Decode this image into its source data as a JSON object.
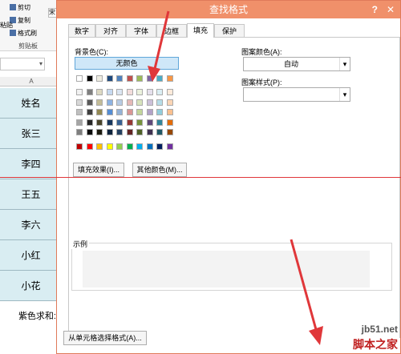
{
  "excel": {
    "clipboard": {
      "cut_label": "剪切",
      "copy_label": "复制",
      "format_painter_label": "格式刷",
      "paste_label": "粘贴",
      "group_label": "剪贴板"
    },
    "font_combo_fragment": "宋",
    "column_header": "A",
    "cells": [
      "姓名",
      "张三",
      "李四",
      "王五",
      "李六",
      "小红",
      "小花"
    ],
    "sum_label": "紫色求和:"
  },
  "dialog": {
    "title": "查找格式",
    "help_glyph": "?",
    "close_glyph": "✕",
    "tabs": [
      {
        "label": "数字",
        "active": false
      },
      {
        "label": "对齐",
        "active": false
      },
      {
        "label": "字体",
        "active": false
      },
      {
        "label": "边框",
        "active": false
      },
      {
        "label": "填充",
        "active": true
      },
      {
        "label": "保护",
        "active": false
      }
    ],
    "fill": {
      "bg_color_label": "背景色(C):",
      "no_color_label": "无颜色",
      "palette_row_top": [
        "#ffffff",
        "#000000",
        "#eeece1",
        "#1f497d",
        "#4f81bd",
        "#c0504d",
        "#9bbb59",
        "#8064a2",
        "#4bacc6",
        "#f79646"
      ],
      "palette_rows": [
        [
          "#f2f2f2",
          "#7f7f7f",
          "#ddd9c3",
          "#c6d9f0",
          "#dbe5f1",
          "#f2dcdb",
          "#ebf1dd",
          "#e5e0ec",
          "#dbeef3",
          "#fdeada"
        ],
        [
          "#d8d8d8",
          "#595959",
          "#c4bd97",
          "#8db3e2",
          "#b8cce4",
          "#e5b9b7",
          "#d7e3bc",
          "#ccc1d9",
          "#b7dde8",
          "#fbd5b5"
        ],
        [
          "#bfbfbf",
          "#3f3f3f",
          "#938953",
          "#548dd4",
          "#95b3d7",
          "#d99694",
          "#c3d69b",
          "#b2a2c7",
          "#92cddc",
          "#fac08f"
        ],
        [
          "#a5a5a5",
          "#262626",
          "#494429",
          "#17365d",
          "#366092",
          "#953734",
          "#76923c",
          "#5f497a",
          "#31859b",
          "#e36c09"
        ],
        [
          "#7f7f7f",
          "#0c0c0c",
          "#1d1b10",
          "#0f243e",
          "#244061",
          "#632423",
          "#4f6128",
          "#3f3151",
          "#205867",
          "#974806"
        ]
      ],
      "palette_standard": [
        "#c00000",
        "#ff0000",
        "#ffc000",
        "#ffff00",
        "#92d050",
        "#00b050",
        "#00b0f0",
        "#0070c0",
        "#002060",
        "#7030a0"
      ],
      "fill_effects_label": "填充效果(I)...",
      "more_colors_label": "其他颜色(M)...",
      "pattern_color_label": "图案颜色(A):",
      "pattern_color_value": "自动",
      "pattern_style_label": "图案样式(P):",
      "pattern_style_value": "",
      "sample_label": "示例"
    },
    "choose_from_cell_label": "从单元格选择格式(A)..."
  },
  "watermark": {
    "site": "jb51.net",
    "name": "脚本之家"
  }
}
